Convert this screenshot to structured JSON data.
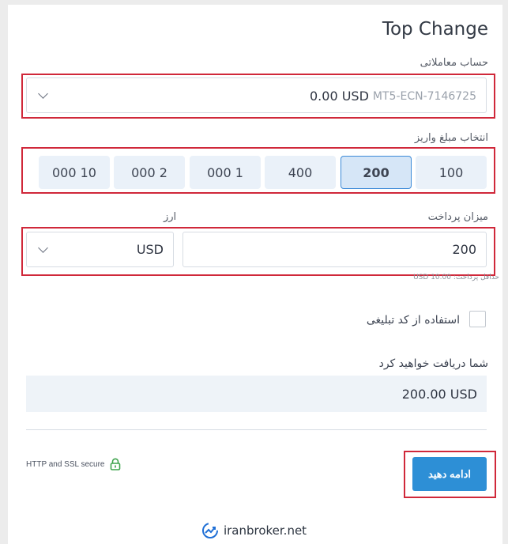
{
  "title": "Top Change",
  "account": {
    "label": "حساب معاملاتی",
    "balance": "0.00 USD",
    "account_id": "MT5-ECN-7146725"
  },
  "deposit_amount": {
    "label": "انتخاب مبلغ واریز",
    "options": [
      "100",
      "200",
      "400",
      "000 1",
      "000 2",
      "000 10"
    ],
    "selected": "200"
  },
  "payment": {
    "amount_label": "میزان پرداخت",
    "amount_value": "200",
    "currency_label": "ارز",
    "currency_value": "USD",
    "min_hint": "حداقل پرداخت: 10.00 USD"
  },
  "promo": {
    "label": "استفاده از کد تبلیغی"
  },
  "receive": {
    "label": "شما دریافت خواهید کرد",
    "value": "200.00 USD"
  },
  "security": {
    "text": "HTTP and SSL secure"
  },
  "submit_label": "ادامه دهید",
  "watermark": "iranbroker.net",
  "colors": {
    "accent": "#2d8fd6",
    "highlight_border": "#d0283a",
    "selected_border": "#3c8ad8",
    "lock_green": "#3fa34d"
  }
}
